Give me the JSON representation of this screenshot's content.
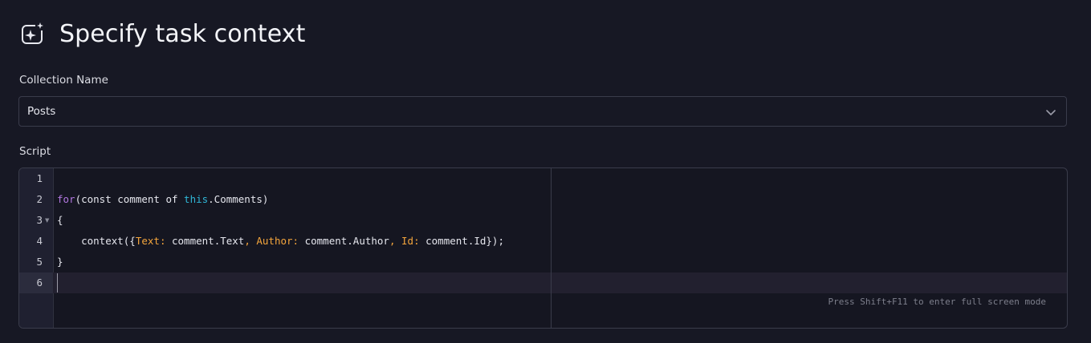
{
  "header": {
    "title": "Specify task context",
    "icon": "sparkle-icon"
  },
  "collection": {
    "label": "Collection Name",
    "selected": "Posts"
  },
  "script": {
    "label": "Script",
    "line_numbers": [
      "1",
      "2",
      "3",
      "4",
      "5",
      "6"
    ],
    "lines": {
      "l2": {
        "kw": "for",
        "pre": "(const comment of ",
        "this_kw": "this",
        "post": ".Comments)"
      },
      "l3": {
        "text": "{"
      },
      "l4": {
        "indent": "    context({",
        "k1": "Text:",
        "v1": " comment.Text",
        "c1": ",",
        "k2": " Author:",
        "v2": " comment.Author",
        "c2": ",",
        "k3": " Id:",
        "v3": " comment.Id});"
      },
      "l5": {
        "text": "}"
      }
    },
    "active_line": 6,
    "fullscreen_hint": "Press Shift+F11 to enter full screen mode"
  },
  "colors": {
    "background": "#171824",
    "keyword": "#b278e0",
    "this_keyword": "#2fb6d6",
    "property_key": "#f4a53c"
  }
}
